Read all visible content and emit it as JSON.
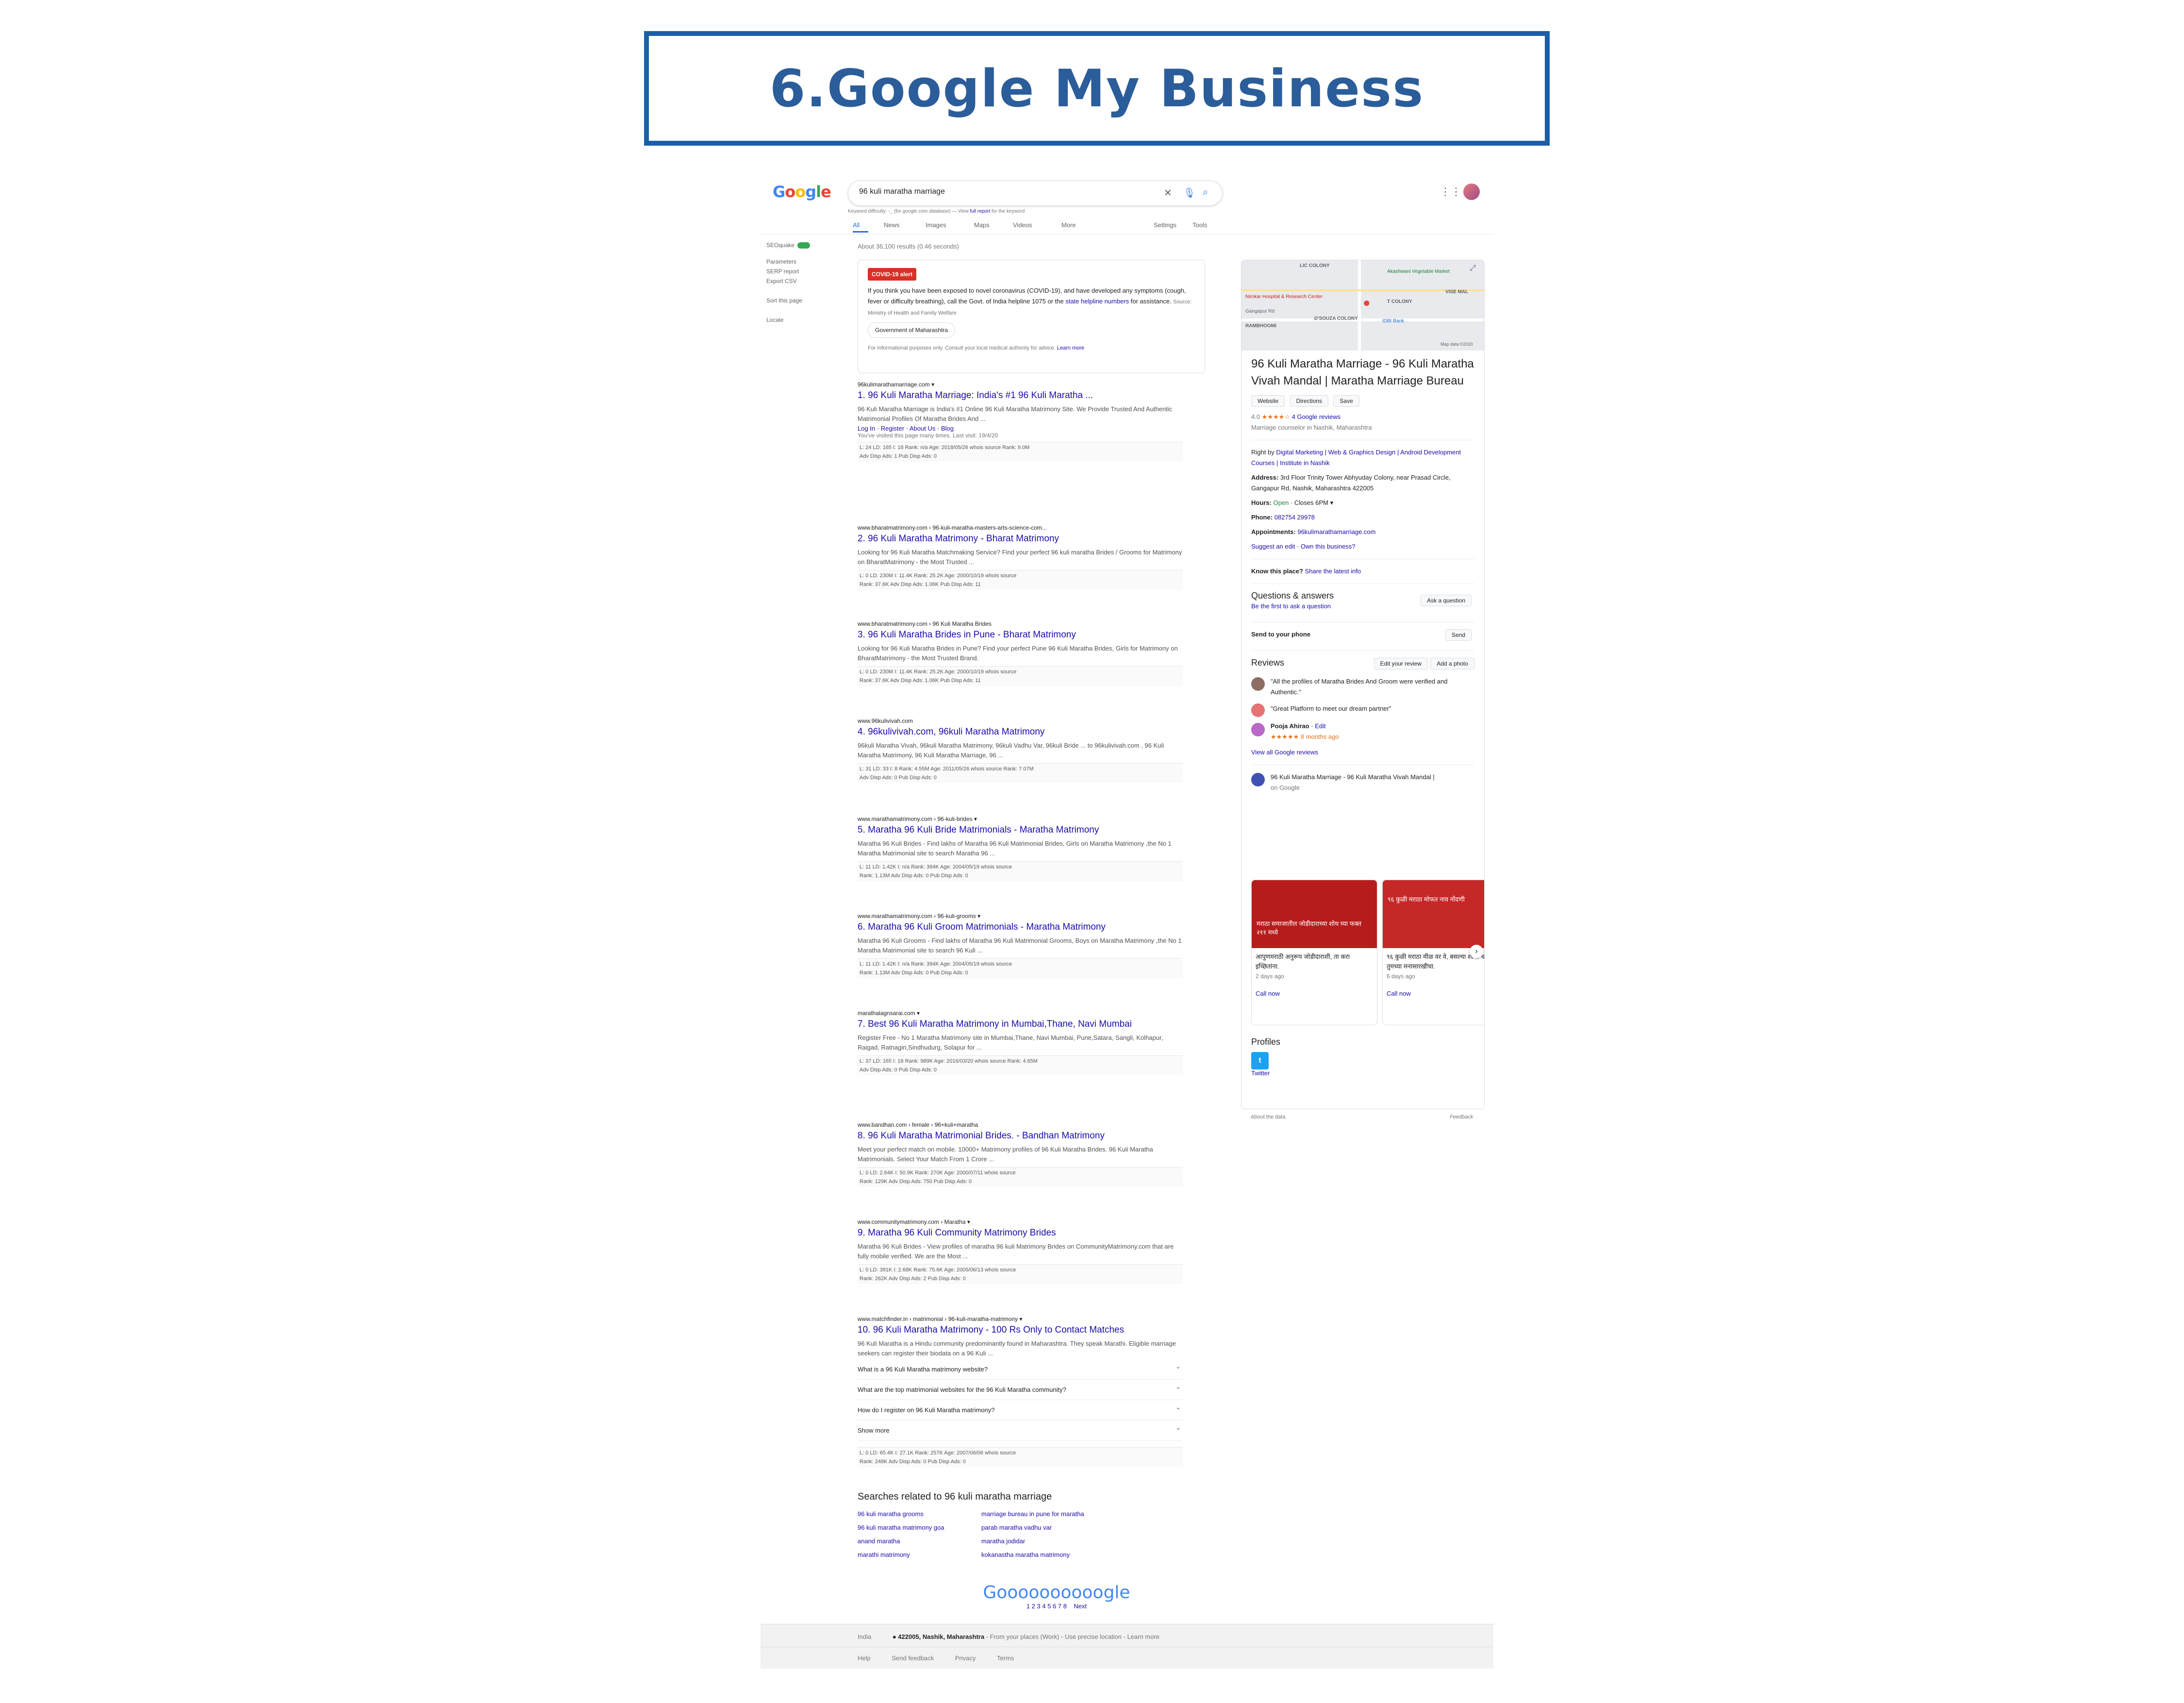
{
  "heading": "6.Google My Business",
  "colors": {
    "accent": "#1a5fa6",
    "link": "#1a0dab",
    "alert": "#d93025"
  },
  "google": {
    "logo": "Google",
    "query": "96 kuli maratha marriage",
    "keyword_note_prefix": "Keyword difficulty: -_  (for google.com database) — View",
    "keyword_note_link": "full report",
    "keyword_note_suffix": "for the keyword",
    "tabs": [
      "All",
      "News",
      "Images",
      "Maps",
      "Videos",
      "More",
      "Settings",
      "Tools"
    ],
    "stats": "About 36,100 results (0.46 seconds)"
  },
  "sidebar": {
    "seoquake": "SEOquake",
    "items": [
      "Parameters",
      "SERP report",
      "Export CSV",
      "Sort this page",
      "Locale"
    ]
  },
  "covid": {
    "badge": "COVID-19 alert",
    "text": "If you think you have been exposed to novel coronavirus (COVID-19), and have developed any symptoms (cough, fever or difficulty breathing), call the Govt. of India helpline 1075 or the",
    "link": "state helpline numbers",
    "tail": "for assistance.",
    "source": "Source: Ministry of Health and Family Welfare",
    "gov": "Government of Maharashtra",
    "note": "For informational purposes only. Consult your local medical authority for advice.",
    "learn": "Learn more"
  },
  "results": [
    {
      "url": "96kulimarathamarriage.com ▾",
      "title": "1. 96 Kuli Maratha Marriage: India's #1 96 Kuli Maratha ...",
      "snippet": "96 Kuli Maratha Marriage is India's #1 Online 96 Kuli Maratha Matrimony Site. We Provide Trusted And Authentic Matrimonial Profiles Of Maratha Brides And ...",
      "links": "Log In · Register · About Us · Blog",
      "visit": "You've visited this page many times. Last visit: 19/4/20",
      "seo1": "L: 24   LD: 165   I: 18   Rank: n/a   Age: 2018/05/26   whois   source   Rank: 9.0M",
      "seo2": "Adv Disp Ads: 1   Pub Disp Ads: 0"
    },
    {
      "url": "www.bharatmatrimony.com › 96-kuli-maratha-masters-arts-science-com...",
      "title": "2. 96 Kuli Maratha Matrimony - Bharat Matrimony",
      "snippet": "Looking for 96 Kuli Maratha Matchmaking Service? Find your perfect 96 kuli maratha Brides / Grooms for Matrimony on BharatMatrimony - the Most Trusted ...",
      "links": "",
      "visit": "",
      "seo1": "L: 0   LD: 230M   I: 11.4K   Rank: 25.2K   Age: 2000/10/19   whois   source",
      "seo2": "Rank: 37.6K   Adv Disp Ads: 1.06K   Pub Disp Ads: 11"
    },
    {
      "url": "www.bharatmatrimony.com › 96 Kuli Maratha Brides",
      "title": "3. 96 Kuli Maratha Brides in Pune - Bharat Matrimony",
      "snippet": "Looking for 96 Kuli Maratha Brides in Pune? Find your perfect Pune 96 Kuli Maratha Brides, Girls for Matrimony on BharatMatrimony - the Most Trusted Brand.",
      "links": "",
      "visit": "",
      "seo1": "L: 0   LD: 230M   I: 11.4K   Rank: 25.2K   Age: 2000/10/19   whois   source",
      "seo2": "Rank: 37.6K   Adv Disp Ads: 1.06K   Pub Disp Ads: 11"
    },
    {
      "url": "www.96kulivivah.com",
      "title": "4. 96kulivivah.com, 96kuli Maratha Matrimony",
      "snippet": "96kuli Maratha Vivah, 96kuli Maratha Matrimony, 96kuli Vadhu Var, 96kuli Bride ... to 96kulivivah.com , 96 Kuli Maratha Matrimony, 96 Kuli Maratha Marriage, 96 ...",
      "links": "",
      "visit": "",
      "seo1": "L: 31   LD: 33   I: 8   Rank: 4.55M   Age: 2011/05/26   whois   source   Rank: 7.07M",
      "seo2": "Adv Disp Ads: 0   Pub Disp Ads: 0"
    },
    {
      "url": "www.marathamatrimony.com › 96-kuli-brides ▾",
      "title": "5. Maratha 96 Kuli Bride Matrimonials - Maratha Matrimony",
      "snippet": "Maratha 96 Kuli Brides - Find lakhs of Maratha 96 Kuli Matrimonial Brides, Girls on Maratha Matrimony ,the No 1 Maratha Matrimonial site to search Maratha 96 ...",
      "links": "",
      "visit": "",
      "seo1": "L: 11   LD: 1.42K   I: n/a   Rank: 394K   Age: 2004/05/19   whois   source",
      "seo2": "Rank: 1.13M   Adv Disp Ads: 0   Pub Disp Ads: 0"
    },
    {
      "url": "www.marathamatrimony.com › 96-kuli-grooms ▾",
      "title": "6. Maratha 96 Kuli Groom Matrimonials - Maratha Matrimony",
      "snippet": "Maratha 96 Kuli Grooms - Find lakhs of Maratha 96 Kuli Matrimonial Grooms, Boys on Maratha Matrimony ,the No 1 Maratha Matrimonial site to search 96 Kuli ...",
      "links": "",
      "visit": "",
      "seo1": "L: 11   LD: 1.42K   I: n/a   Rank: 394K   Age: 2004/05/19   whois   source",
      "seo2": "Rank: 1.13M   Adv Disp Ads: 0   Pub Disp Ads: 0"
    },
    {
      "url": "marathalagnsarai.com ▾",
      "title": "7. Best 96 Kuli Maratha Matrimony in Mumbai,Thane, Navi Mumbai",
      "snippet": "Register Free - No 1 Maratha Matrimony site in Mumbai,Thane, Navi Mumbai, Pune,Satara, Sangli, Kolhapur, Raigad, Ratnagiri,Sindhudurg, Solapur for ...",
      "links": "",
      "visit": "",
      "seo1": "L: 37   LD: 165   I: 18   Rank: 989K   Age: 2016/03/20   whois   source   Rank: 4.65M",
      "seo2": "Adv Disp Ads: 0   Pub Disp Ads: 0"
    },
    {
      "url": "www.bandhan.com › female › 96+kuli+maratha",
      "title": "8. 96 Kuli Maratha Matrimonial Brides. - Bandhan Matrimony",
      "snippet": "Meet your perfect match on mobile. 10000+ Matrimony profiles of 96 Kuli Maratha Brides. 96 Kuli Maratha Matrimonials. Select Your Match From 1 Crore ...",
      "links": "",
      "visit": "",
      "seo1": "L: 0   LD: 2.64K   I: 50.9K   Rank: 270K   Age: 2000/07/11   whois   source",
      "seo2": "Rank: 129K   Adv Disp Ads: 750   Pub Disp Ads: 0"
    },
    {
      "url": "www.communitymatrimony.com › Maratha ▾",
      "title": "9. Maratha 96 Kuli Community Matrimony Brides",
      "snippet": "Maratha 96 Kuli Brides - View profiles of maratha 96 kuli Matrimony Brides on CommunityMatrimony.com that are fully mobile verified. We are the Most ...",
      "links": "",
      "visit": "",
      "seo1": "L: 0   LD: 391K   I: 2.68K   Rank: 75.6K   Age: 2005/06/13   whois   source",
      "seo2": "Rank: 262K   Adv Disp Ads: 2   Pub Disp Ads: 0"
    },
    {
      "url": "www.matchfinder.in › matrimonial › 96-kuli-maratha-matrimony ▾",
      "title": "10. 96 Kuli Maratha Matrimony - 100 Rs Only to Contact Matches",
      "snippet": "96 Kuli Maratha is a Hindu community predominantly found in Maharashtra. They speak Marathi. Eligible marriage seekers can register their biodata on a 96 Kuli ...",
      "links": "",
      "visit": "",
      "seo1": "",
      "seo2": ""
    }
  ],
  "faq": [
    "What is a 96 Kuli Maratha matrimony website?",
    "What are the top matrimonial websites for the 96 Kuli Maratha community?",
    "How do I register on 96 Kuli Maratha matrimony?",
    "Show more"
  ],
  "last_seo": {
    "seo1": "L: 0   LD: 65.4K   I: 27.1K   Rank: 257K   Age: 2007/06/06   whois   source",
    "seo2": "Rank: 248K   Adv Disp Ads: 0   Pub Disp Ads: 0"
  },
  "related": {
    "title": "Searches related to 96 kuli maratha marriage",
    "items": [
      "96 kuli maratha grooms",
      "marriage bureau in pune for maratha",
      "96 kuli maratha matrimony goa",
      "parab maratha vadhu var",
      "anand maratha",
      "maratha jodidar",
      "marathi matrimony",
      "kokanastha maratha matrimony"
    ]
  },
  "pager": {
    "logo": "Goooooooooogle",
    "pages": "1  2  3  4  5  6  7  8",
    "next": "Next"
  },
  "footer": {
    "country": "India",
    "location": "● 422005, Nashik, Maharashtra",
    "loc_note": "- From your places (Work) - Use precise location - Learn more",
    "links": [
      "Help",
      "Send feedback",
      "Privacy",
      "Terms"
    ]
  },
  "panel": {
    "map_labels": [
      "LIC COLONY",
      "Akashwani Vegetable Market",
      "Nirnkar Hospital & Research Center",
      "Gangapur Rd",
      "T COLONY",
      "VISE MAL",
      "RAMBHOOMI",
      "D'SOUZA COLONY",
      "IDBI Bank",
      "Map data ©2020"
    ],
    "name": "96 Kuli Maratha Marriage - 96 Kuli Maratha Vivah Mandal | Maratha Marriage Bureau",
    "buttons": [
      "Website",
      "Directions",
      "Save"
    ],
    "rating": "4.0",
    "stars": "★★★★☆",
    "reviews_count": "4 Google reviews",
    "category": "Marriage counselor in Nashik, Maharashtra",
    "owner_prefix": "Right by",
    "owner_link": "Digital Marketing | Web & Graphics Design | Android Development Courses | Institute in Nashik",
    "address_label": "Address:",
    "address": "3rd Floor Trinity Tower Abhyuday Colony, near Prasad Circle, Gangapur Rd, Nashik, Maharashtra 422005",
    "hours_label": "Hours:",
    "hours_open": "Open",
    "hours_rest": "· Closes 6PM ▾",
    "phone_label": "Phone:",
    "phone": "082754 29978",
    "appt_label": "Appointments:",
    "appt": "96kulimarathamarriage.com",
    "suggest": "Suggest an edit · Own this business?",
    "know_label": "Know this place?",
    "know_link": "Share the latest info",
    "qa_title": "Questions & answers",
    "qa_sub": "Be the first to ask a question",
    "qa_btn": "Ask a question",
    "send_label": "Send to your phone",
    "send_btn": "Send",
    "reviews_title": "Reviews",
    "review_btns": [
      "Edit your review",
      "Add a photo"
    ],
    "review1": "\"All the profiles of Maratha Brides And Groom were verified and Authentic.\"",
    "review2": "\"Great Platform to meet our dream partner\"",
    "reviewer": "Pooja Ahirao",
    "reviewer_edit": "· Edit",
    "reviewer_time": "★★★★★  8 months ago",
    "view_all": "View all Google reviews",
    "post_from": "96 Kuli Maratha Marriage - 96 Kuli Maratha Vivah Mandal |",
    "post_on": "on Google",
    "posts": [
      {
        "img_text": "मराठा समाजातील जोडीदाराच्या शोध घ्या फक्त २११ मध्ये",
        "text": "आपुणमराठी अनुरूप जोडीदाराशी, ता करा इच्छितांना.",
        "time": "2 days ago",
        "cta": "Call now"
      },
      {
        "img_text": "९६ कुळी मराठा मोफत नाव नोंदणी",
        "text": "९६ कुळी मराठा मीळ वर वे, बसल्या शोधा चा तुमच्या मनासारखीचा.",
        "time": "6 days ago",
        "cta": "Call now"
      }
    ],
    "profiles_title": "Profiles",
    "twitter": "Twitter",
    "about": "About the data",
    "feedback": "Feedback"
  }
}
